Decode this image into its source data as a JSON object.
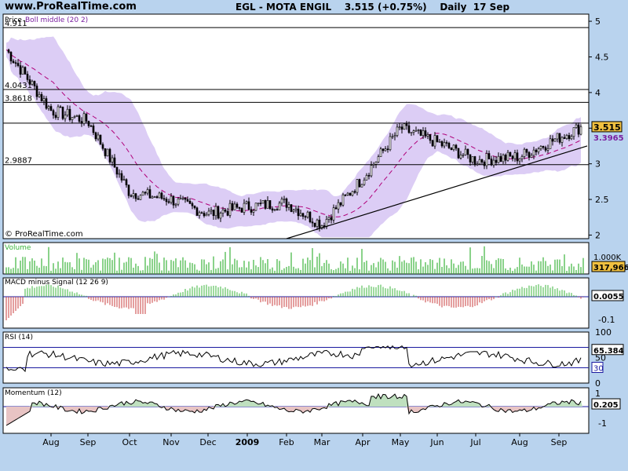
{
  "header": {
    "site": "www.ProRealTime.com",
    "title": "EGL - MOTA ENGIL",
    "price": "3.515 (+0.75%)",
    "period": "Daily",
    "date": "17 Sep"
  },
  "colors": {
    "background": "#b9d3ee",
    "panel": "#ffffff",
    "bollinger_band": "#d8c8f4",
    "bollinger_middle": "#b0007a",
    "volume": "#3cb43c",
    "macd_positive": "#3cb43c",
    "macd_negative": "#c83c3c",
    "rsi_line": "#000000",
    "rsi_levels": "#1a1aa0",
    "momentum_positive_fill": "#bfe0bf",
    "momentum_negative_fill": "#e8c4c4",
    "last_price_badge": "#f0c040"
  },
  "chart_data": [
    {
      "panel": "price",
      "type": "candlestick",
      "title": "Price",
      "indicator": "Boll middle (20 2)",
      "watermark": "© ProRealTime.com",
      "x_ticks": [
        "Aug",
        "Sep",
        "Oct",
        "Nov",
        "Dec",
        "2009",
        "Feb",
        "Mar",
        "Apr",
        "May",
        "Jun",
        "Jul",
        "Aug",
        "Sep"
      ],
      "y_ticks": [
        "2",
        "2.5",
        "3",
        "3.5",
        "4",
        "4.5",
        "5"
      ],
      "ylim": [
        1.95,
        5.1
      ],
      "series": [
        {
          "name": "Price",
          "values_by_month": [
            {
              "month": "Jul",
              "close": 4.6
            },
            {
              "month": "Aug",
              "close": 3.75
            },
            {
              "month": "Sep",
              "close": 3.6
            },
            {
              "month": "Oct",
              "close": 2.6
            },
            {
              "month": "Nov",
              "close": 2.5
            },
            {
              "month": "Dec",
              "close": 2.3
            },
            {
              "month": "Jan",
              "close": 2.4
            },
            {
              "month": "Feb",
              "close": 2.45
            },
            {
              "month": "Mar",
              "close": 2.15
            },
            {
              "month": "Apr",
              "close": 2.8
            },
            {
              "month": "May",
              "close": 3.5
            },
            {
              "month": "Jun",
              "close": 3.3
            },
            {
              "month": "Jul",
              "close": 3.05
            },
            {
              "month": "Aug",
              "close": 3.1
            },
            {
              "month": "Sep",
              "close": 3.515
            }
          ]
        }
      ],
      "horizontal_levels": [
        {
          "label": "4.911",
          "value": 4.911
        },
        {
          "label": "4.0431",
          "value": 4.0431
        },
        {
          "label": "3.8618",
          "value": 3.8618
        },
        {
          "label": "",
          "value": 3.57
        },
        {
          "label": "2.9887",
          "value": 2.9887
        }
      ],
      "trendline": {
        "from": {
          "month": "Feb",
          "value": 1.95
        },
        "to": {
          "month": "Sep",
          "value": 3.25
        }
      },
      "last_price": "3.515",
      "boll_middle_last": "3.3965"
    },
    {
      "panel": "volume",
      "type": "bar",
      "title": "Volume",
      "y_ticks": [
        "1.000K"
      ],
      "last_value": "317,966"
    },
    {
      "panel": "macd",
      "type": "bar",
      "title": "MACD minus Signal (12 26 9)",
      "y_ticks": [
        "-0.1"
      ],
      "last_value": "0.0055"
    },
    {
      "panel": "rsi",
      "type": "line",
      "title": "RSI (14)",
      "y_ticks": [
        "100",
        "50",
        "0"
      ],
      "ylim": [
        0,
        100
      ],
      "levels": [
        70,
        30
      ],
      "last_value": "65.384",
      "lower_level_label": "30"
    },
    {
      "panel": "momentum",
      "type": "area",
      "title": "Momentum (12)",
      "y_ticks": [
        "1",
        "0",
        "-1"
      ],
      "last_value": "0.205"
    }
  ]
}
